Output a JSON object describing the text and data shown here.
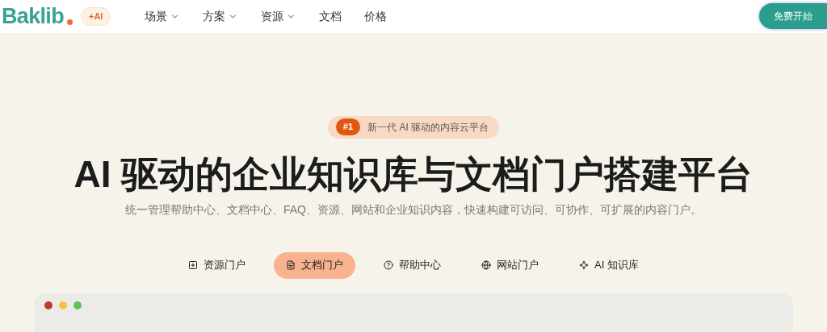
{
  "nav": {
    "logo": "Baklib",
    "ai_badge": "+AI",
    "items": [
      {
        "label": "场景",
        "dropdown": true
      },
      {
        "label": "方案",
        "dropdown": true
      },
      {
        "label": "资源",
        "dropdown": true
      },
      {
        "label": "文档",
        "dropdown": false
      },
      {
        "label": "价格",
        "dropdown": false
      }
    ],
    "cta": "免费开始"
  },
  "hero": {
    "badge_rank": "#1",
    "badge_text": "新一代 AI 驱动的内容云平台",
    "title": "AI 驱动的企业知识库与文档门户搭建平台",
    "subtitle": "统一管理帮助中心、文档中心、FAQ、资源、网站和企业知识内容，快速构建可访问、可协作、可扩展的内容门户。"
  },
  "tabs": [
    {
      "label": "资源门户",
      "selected": false
    },
    {
      "label": "文档门户",
      "selected": true
    },
    {
      "label": "帮助中心",
      "selected": false
    },
    {
      "label": "网站门户",
      "selected": false
    },
    {
      "label": "AI 知识库",
      "selected": false
    }
  ],
  "preview": {
    "window_dots": [
      {
        "color": "#c0392b"
      },
      {
        "color": "#f5c342"
      },
      {
        "color": "#5cc25a"
      }
    ]
  }
}
